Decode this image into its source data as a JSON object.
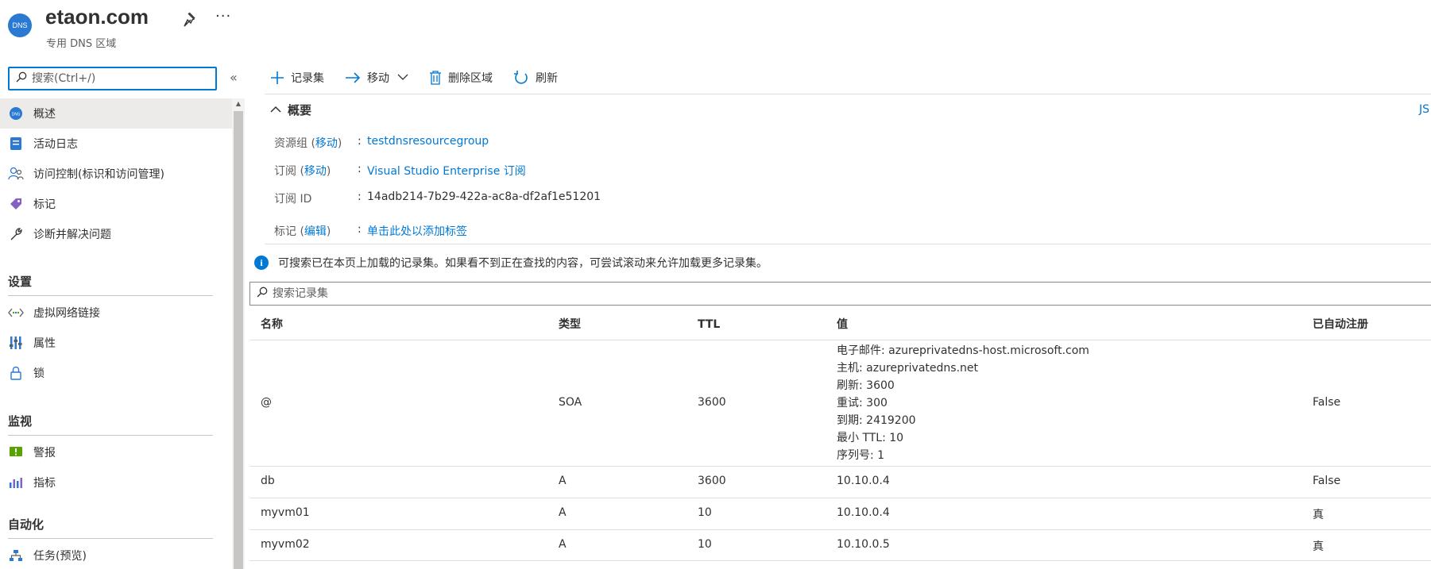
{
  "header": {
    "icon_text": "DNS",
    "title": "etaon.com",
    "subtitle": "专用 DNS 区域",
    "more": "···"
  },
  "sidebar": {
    "search_placeholder": "搜索(Ctrl+/)",
    "collapse": "«",
    "items": [
      {
        "label": "概述",
        "icon": "dns-icon"
      },
      {
        "label": "活动日志",
        "icon": "activity-log-icon"
      },
      {
        "label": "访问控制(标识和访问管理)",
        "icon": "people-icon"
      },
      {
        "label": "标记",
        "icon": "tag-icon"
      },
      {
        "label": "诊断并解决问题",
        "icon": "wrench-icon"
      }
    ],
    "sections": [
      {
        "title": "设置",
        "items": [
          {
            "label": "虚拟网络链接",
            "icon": "link-icon"
          },
          {
            "label": "属性",
            "icon": "properties-icon"
          },
          {
            "label": "锁",
            "icon": "lock-icon"
          }
        ]
      },
      {
        "title": "监视",
        "items": [
          {
            "label": "警报",
            "icon": "alert-icon"
          },
          {
            "label": "指标",
            "icon": "metrics-icon"
          }
        ]
      },
      {
        "title": "自动化",
        "items": [
          {
            "label": "任务(预览)",
            "icon": "tasks-icon"
          }
        ]
      }
    ]
  },
  "toolbar": {
    "add_recordset": "记录集",
    "move": "移动",
    "delete_zone": "删除区域",
    "refresh": "刷新"
  },
  "essentials": {
    "title": "概要",
    "json_link": "JS",
    "rows": [
      {
        "key": "资源组",
        "key_link": "移动",
        "value": "testdnsresourcegroup",
        "value_is_link": true
      },
      {
        "key": "订阅",
        "key_link": "移动",
        "value": "Visual Studio Enterprise 订阅",
        "value_is_link": true
      },
      {
        "key": "订阅 ID",
        "key_link": "",
        "value": "14adb214-7b29-422a-ac8a-df2af1e51201",
        "value_is_link": false
      },
      {
        "key": "标记",
        "key_link": "编辑",
        "value": "单击此处以添加标签",
        "value_is_link": true
      }
    ]
  },
  "info_text": "可搜索已在本页上加载的记录集。如果看不到正在查找的内容，可尝试滚动来允许加载更多记录集。",
  "records_search_placeholder": "搜索记录集",
  "table": {
    "headers": [
      "名称",
      "类型",
      "TTL",
      "值",
      "已自动注册"
    ],
    "rows": [
      {
        "name": "@",
        "type": "SOA",
        "ttl": "3600",
        "value": [
          "电子邮件: azureprivatedns-host.microsoft.com",
          "主机: azureprivatedns.net",
          "刷新: 3600",
          "重试: 300",
          "到期: 2419200",
          "最小 TTL: 10",
          "序列号: 1"
        ],
        "auto": "False"
      },
      {
        "name": "db",
        "type": "A",
        "ttl": "3600",
        "value": [
          "10.10.0.4"
        ],
        "auto": "False"
      },
      {
        "name": "myvm01",
        "type": "A",
        "ttl": "10",
        "value": [
          "10.10.0.4"
        ],
        "auto": "真"
      },
      {
        "name": "myvm02",
        "type": "A",
        "ttl": "10",
        "value": [
          "10.10.0.5"
        ],
        "auto": "真"
      }
    ]
  },
  "colors": {
    "accent": "#0078d4",
    "active_bg": "#edebe9"
  }
}
